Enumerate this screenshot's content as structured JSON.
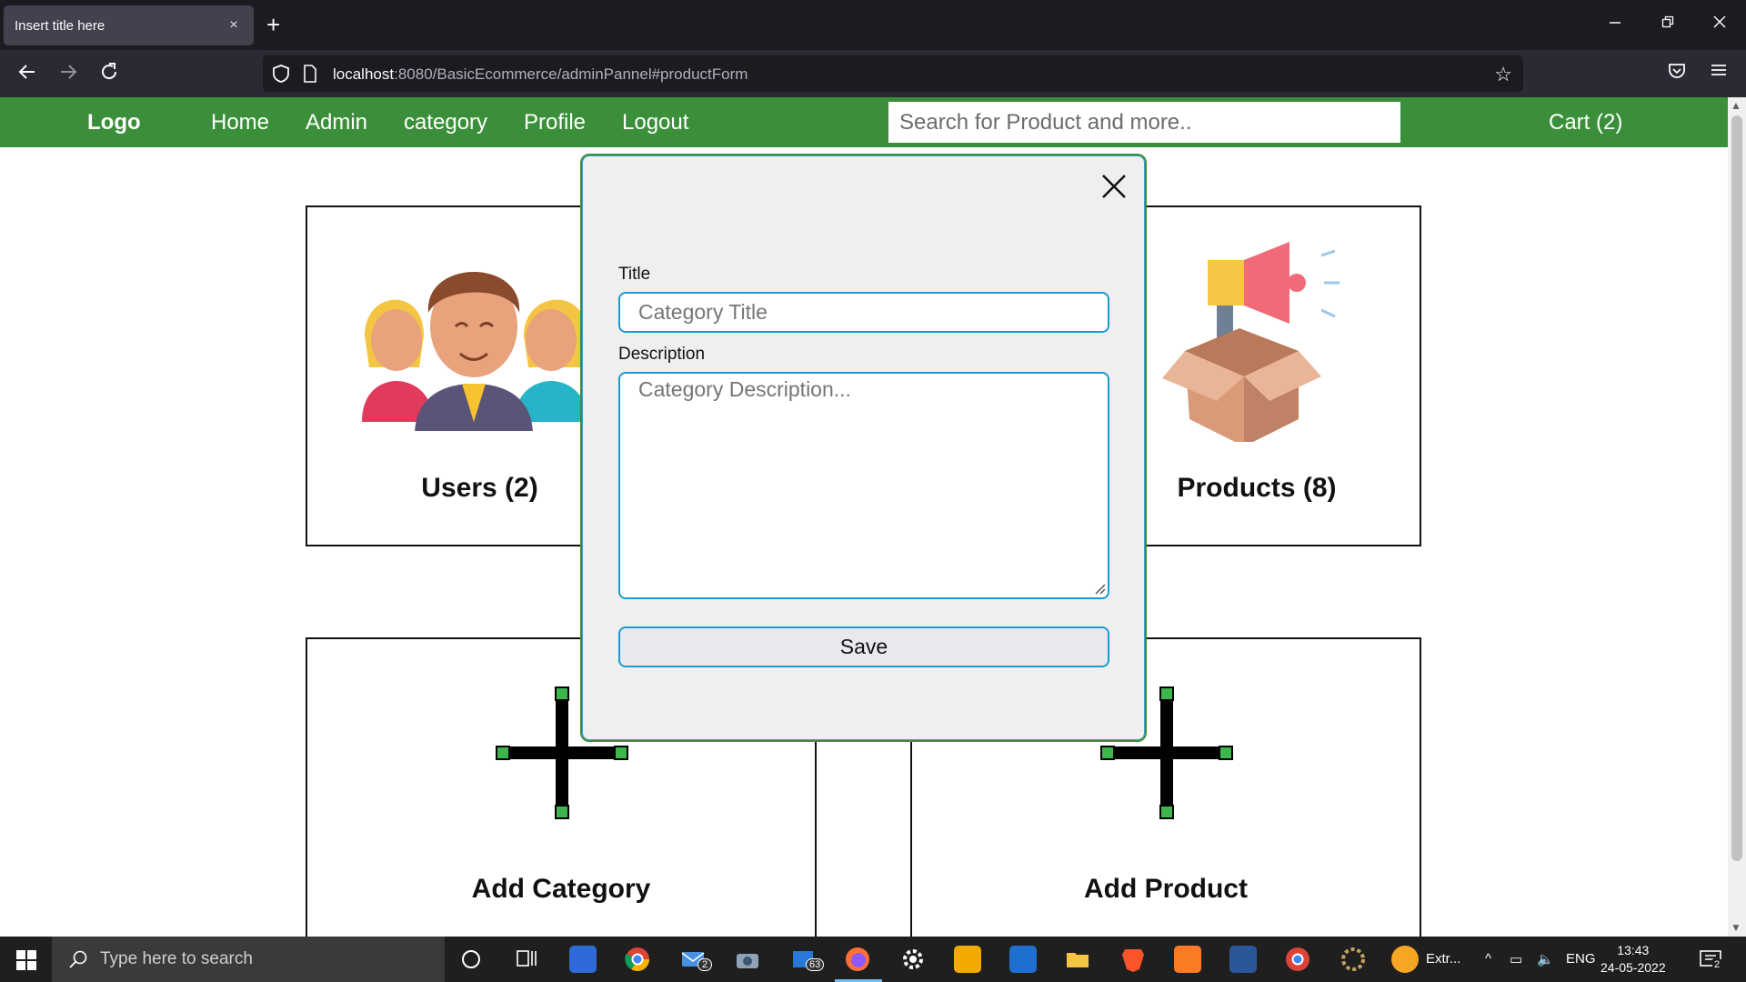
{
  "browser": {
    "tab_title": "Insert title here",
    "tab_close": "×",
    "new_tab": "+",
    "url_host": "localhost",
    "url_rest": ":8080/BasicEcommerce/adminPannel#productForm"
  },
  "site": {
    "logo": "Logo",
    "nav": [
      "Home",
      "Admin",
      "category",
      "Profile",
      "Logout"
    ],
    "search_placeholder": "Search for Product and more..",
    "cart": "Cart (2)",
    "brand_color": "#3c8f3a"
  },
  "cards": {
    "users": "Users (2)",
    "products": "Products (8)",
    "add_category": "Add Category",
    "add_product": "Add Product"
  },
  "modal": {
    "title_label": "Title",
    "title_placeholder": "Category Title",
    "description_label": "Description",
    "description_placeholder": "Category Description...",
    "save_label": "Save",
    "border_color": "#1b9bd1"
  },
  "taskbar": {
    "search_placeholder": "Type here to search",
    "mail_badge": "2",
    "store_badge": "63",
    "tray_extra": "Extr...",
    "language": "ENG",
    "time": "13:43",
    "date": "24-05-2022",
    "notification_badge": "2"
  }
}
